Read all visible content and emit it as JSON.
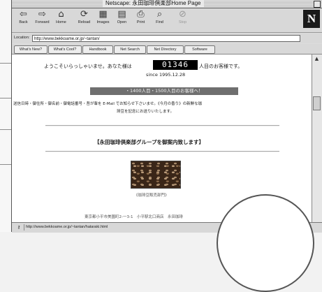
{
  "window": {
    "title": "Netscape: 永田珈琲倶楽部Home Page"
  },
  "toolbar": {
    "buttons": [
      {
        "label": "Back",
        "icon": "back-arrow-icon",
        "glyph": "⇦",
        "enabled": true
      },
      {
        "label": "Forward",
        "icon": "forward-arrow-icon",
        "glyph": "⇨",
        "enabled": true
      },
      {
        "label": "Home",
        "icon": "home-icon",
        "glyph": "⌂",
        "enabled": true
      },
      {
        "label": "Reload",
        "icon": "reload-icon",
        "glyph": "⟳",
        "enabled": true
      },
      {
        "label": "Images",
        "icon": "images-icon",
        "glyph": "▦",
        "enabled": true
      },
      {
        "label": "Open",
        "icon": "open-icon",
        "glyph": "▤",
        "enabled": true
      },
      {
        "label": "Print",
        "icon": "print-icon",
        "glyph": "⎙",
        "enabled": true
      },
      {
        "label": "Find",
        "icon": "find-icon",
        "glyph": "⌕",
        "enabled": true
      },
      {
        "label": "Stop",
        "icon": "stop-icon",
        "glyph": "⊘",
        "enabled": false
      }
    ],
    "logo": "N"
  },
  "location": {
    "label": "Location:",
    "url": "http://www.bekkoame.or.jp/~tantan/"
  },
  "directory_buttons": [
    "What's New?",
    "What's Cool?",
    "Handbook",
    "Net Search",
    "Net Directory",
    "Software"
  ],
  "content": {
    "welcome_prefix": "ようこそいらっしゃいませ。あなた様は",
    "counter": "01346",
    "welcome_suffix": "人目のお客様です。",
    "since": "since 1995.12.28",
    "visitor_banner": "・1400人目・1500人目のお客様へ！",
    "notice_line1": "送信日時・御住所・御名前・御電話番号・吾が輩を E-Mail でお知らせ下さいませ。《今月の香り》の新鮮な珈",
    "notice_line2": "琲豆を記念にお送りいたします。",
    "section_title": "【永田珈琲倶楽部グループを御案内致します】",
    "image_caption": "《珈琲豆販売部門》",
    "bottom_text": "東京都小平市美園町2-一3-1　小平駅北口商店　永田珈琲"
  },
  "status": {
    "text": "http://www.bekkoame.or.jp/~tantan/hataraki.html"
  }
}
